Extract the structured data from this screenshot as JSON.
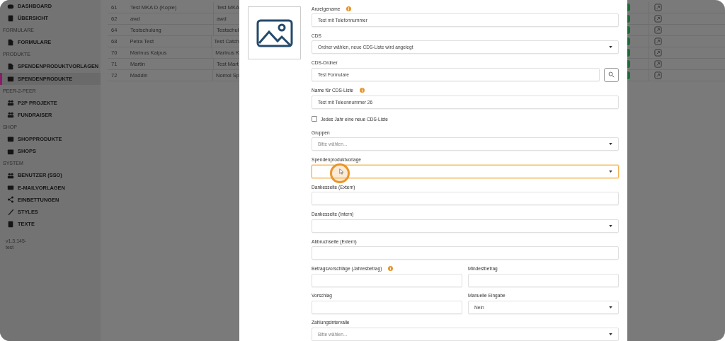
{
  "sidebar": {
    "items": [
      {
        "kind": "item",
        "label": "DASHBOARD",
        "selected": false
      },
      {
        "kind": "item",
        "label": "ÜBERSICHT",
        "selected": false
      },
      {
        "kind": "heading",
        "label": "FORMULARE"
      },
      {
        "kind": "item",
        "label": "FORMULARE",
        "selected": false
      },
      {
        "kind": "heading",
        "label": "PRODUKTE"
      },
      {
        "kind": "item",
        "label": "SPENDENPRODUKTVORLAGEN",
        "selected": false
      },
      {
        "kind": "item",
        "label": "SPENDENPRODUKTE",
        "selected": true
      },
      {
        "kind": "heading",
        "label": "PEER-2-PEER"
      },
      {
        "kind": "item",
        "label": "P2P PROJEKTE",
        "selected": false
      },
      {
        "kind": "item",
        "label": "FUNDRAISER",
        "selected": false
      },
      {
        "kind": "heading",
        "label": "SHOP"
      },
      {
        "kind": "item",
        "label": "SHOPPRODUKTE",
        "selected": false
      },
      {
        "kind": "item",
        "label": "SHOPS",
        "selected": false
      },
      {
        "kind": "heading",
        "label": "SYSTEM"
      },
      {
        "kind": "item",
        "label": "BENUTZER (SSO)",
        "selected": false
      },
      {
        "kind": "item",
        "label": "E-MAILVORLAGEN",
        "selected": false
      },
      {
        "kind": "item",
        "label": "EINBETTUNGEN",
        "selected": false
      },
      {
        "kind": "item",
        "label": "STYLES",
        "selected": false
      },
      {
        "kind": "item",
        "label": "TEXTE",
        "selected": false
      }
    ],
    "version": "v1.3.145-",
    "environment": "test"
  },
  "table": {
    "rows": [
      {
        "id": "61",
        "name": "Test MKA D (Kopie)",
        "column_3": "Test MKA",
        "color": "#1e6b3a"
      },
      {
        "id": "62",
        "name": "awd",
        "column_3": "awd",
        "color": "#1e6b3a"
      },
      {
        "id": "64",
        "name": "Testschulung",
        "column_3": "Testschul",
        "color": "#1e6b3a"
      },
      {
        "id": "68",
        "name": "Petra Test",
        "column_3": "Test Catch",
        "color": "#1e6b3a"
      },
      {
        "id": "70",
        "name": "Marinus Kaipus",
        "column_3": "Marinus K",
        "color": "#1e6b3a"
      },
      {
        "id": "71",
        "name": "Martin",
        "column_3": "Test Mart",
        "color": "#1e6b3a"
      },
      {
        "id": "72",
        "name": "Maddin",
        "column_3": "Nomoi Sp",
        "color": "#1e6b3a"
      }
    ]
  },
  "form": {
    "fields": [
      {
        "kind": "text",
        "label": "Anzeigename",
        "info": true,
        "focused": false,
        "value": "Test mit Telefonnummer"
      },
      {
        "kind": "select",
        "label": "CDS",
        "focused": false,
        "value": "Ordner wählen, neue CDS-Liste wird angelegt"
      },
      {
        "kind": "search",
        "label": "CDS-Ordner",
        "focused": false,
        "value": "Test Formulare"
      },
      {
        "kind": "text",
        "label": "Name für CDS-Liste",
        "info": true,
        "focused": false,
        "value": "Test mit Teleonnummer 26"
      },
      {
        "kind": "checkbox",
        "label": "Jedes Jahr eine neue CDS-Liste",
        "checked": false
      },
      {
        "kind": "select",
        "label": "Gruppen",
        "focused": false,
        "placeholder": "Bitte wählen..."
      },
      {
        "kind": "select",
        "label": "Spendenproduktvorlage",
        "focused": true
      },
      {
        "kind": "text",
        "label": "Dankesseite (Extern)",
        "focused": false
      },
      {
        "kind": "select",
        "label": "Dankesseite (Intern)",
        "focused": false
      },
      {
        "kind": "text",
        "label": "Abbruchseite (Extern)",
        "focused": false
      },
      {
        "kind": "pair",
        "fields": [
          {
            "kind": "text",
            "label": "Betragsvorschläge (Jahresbetrag)",
            "info": true,
            "focused": false
          },
          {
            "kind": "text",
            "label": "Mindestbetrag",
            "focused": false
          }
        ]
      },
      {
        "kind": "pair",
        "fields": [
          {
            "kind": "text",
            "label": "Vorschlag",
            "focused": false
          },
          {
            "kind": "select",
            "label": "Manuelle Eingabe",
            "focused": false,
            "value": "Nein"
          }
        ]
      },
      {
        "kind": "select",
        "label": "Zahlungsintervalle",
        "focused": false,
        "placeholder": "Bitte wählen..."
      }
    ]
  }
}
